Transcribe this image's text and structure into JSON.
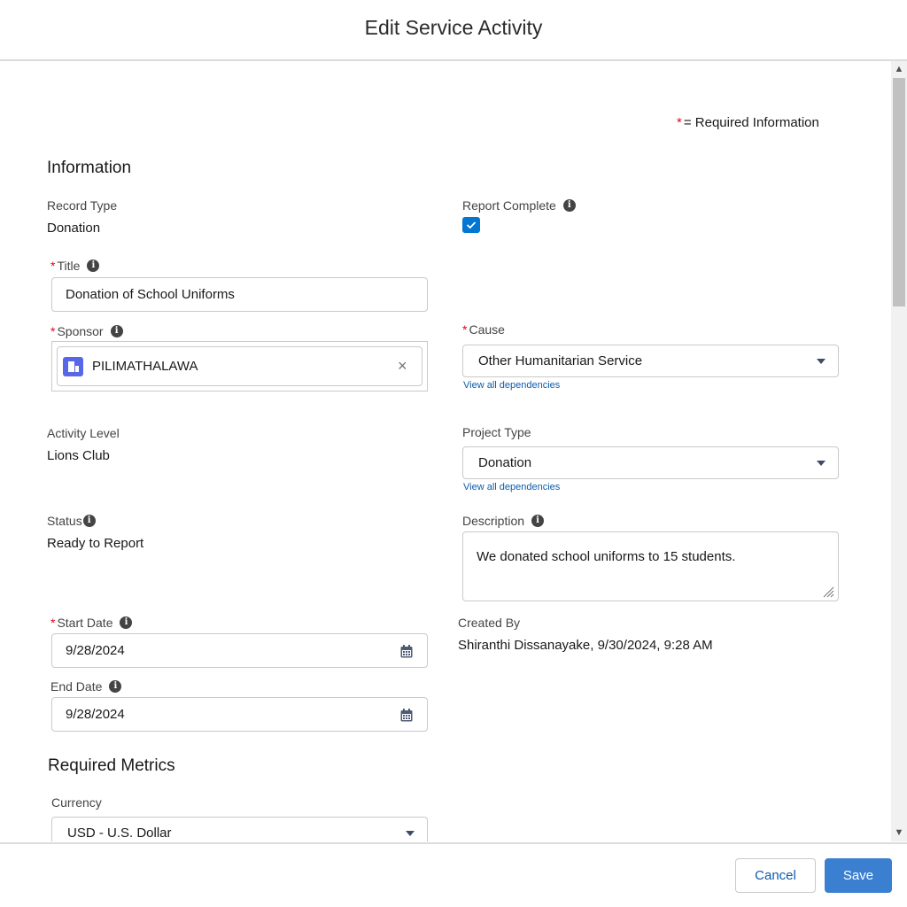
{
  "modal": {
    "title": "Edit Service Activity"
  },
  "legend": {
    "asterisk": "*",
    "text": "= Required Information"
  },
  "sections": {
    "information": "Information",
    "required_metrics": "Required Metrics"
  },
  "fields": {
    "record_type": {
      "label": "Record Type",
      "value": "Donation"
    },
    "report_complete": {
      "label": "Report Complete",
      "checked": true
    },
    "title": {
      "label": "Title",
      "value": "Donation of School Uniforms"
    },
    "sponsor": {
      "label": "Sponsor",
      "value": "PILIMATHALAWA",
      "icon": "account-icon"
    },
    "cause": {
      "label": "Cause",
      "value": "Other Humanitarian Service",
      "link": "View all dependencies"
    },
    "activity_level": {
      "label": "Activity Level",
      "value": "Lions Club"
    },
    "project_type": {
      "label": "Project Type",
      "value": "Donation",
      "link": "View all dependencies"
    },
    "status": {
      "label": "Status",
      "value": "Ready to Report"
    },
    "description": {
      "label": "Description",
      "value": "We donated school uniforms to 15 students."
    },
    "start_date": {
      "label": "Start Date",
      "value": "9/28/2024"
    },
    "created_by": {
      "label": "Created By",
      "value": "Shiranthi Dissanayake, 9/30/2024, 9:28 AM"
    },
    "end_date": {
      "label": "End Date",
      "value": "9/28/2024"
    },
    "currency": {
      "label": "Currency",
      "value": "USD - U.S. Dollar"
    }
  },
  "footer": {
    "cancel_label": "Cancel",
    "save_label": "Save"
  },
  "colors": {
    "primary": "#0176d3",
    "save_button": "#3b7fd1",
    "required": "#ea001e",
    "link": "#0b5cab"
  }
}
